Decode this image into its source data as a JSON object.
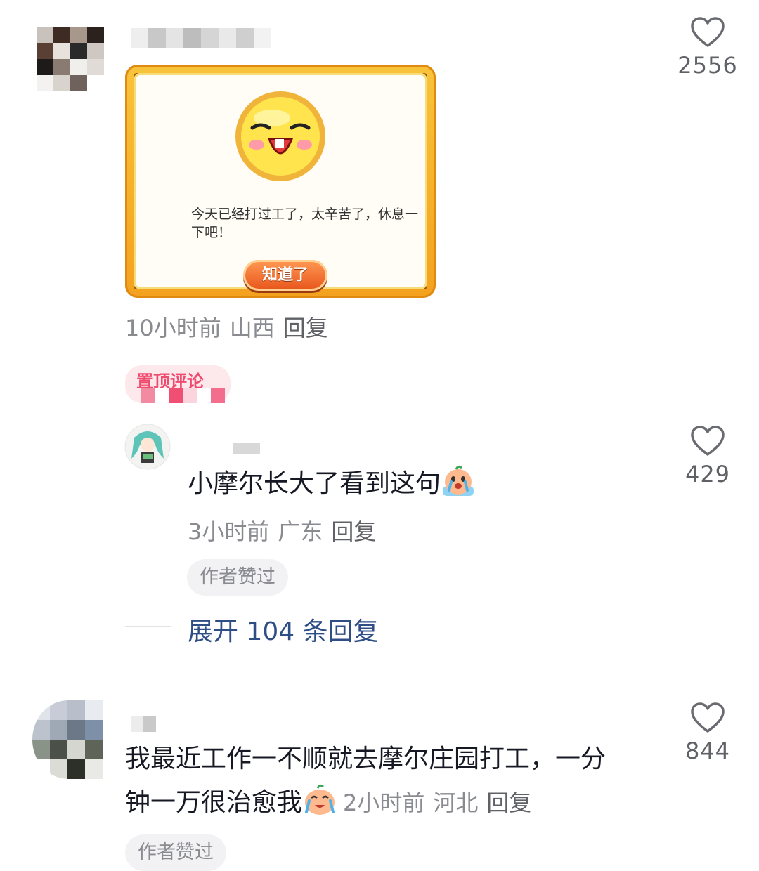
{
  "comments": [
    {
      "username": "",
      "image_caption": "今天已经打过工了，太辛苦了，休息一下吧！",
      "image_button": "知道了",
      "meta": {
        "time": "10小时前",
        "location": "山西",
        "reply": "回复"
      },
      "pinned_label": "置顶评论",
      "likes": "2556"
    },
    {
      "username": "",
      "text": "小摩尔长大了看到这句",
      "emoji": "crying-emoji",
      "meta": {
        "time": "3小时前",
        "location": "广东",
        "reply": "回复"
      },
      "badge": "作者赞过",
      "likes": "429",
      "expand_replies": "展开 104 条回复"
    },
    {
      "username": "",
      "text_line1": "我最近工作一不顺就去摩尔庄园打工，一分",
      "text_line2": "钟一万很治愈我",
      "emoji": "crying-emoji",
      "meta": {
        "time": "2小时前",
        "location": "河北",
        "reply": "回复"
      },
      "badge": "作者赞过",
      "likes": "844"
    }
  ],
  "colors": {
    "text": "#161823",
    "meta": "#8a8b91",
    "link": "#2f4e85",
    "pinned": "#ef4b6f"
  }
}
